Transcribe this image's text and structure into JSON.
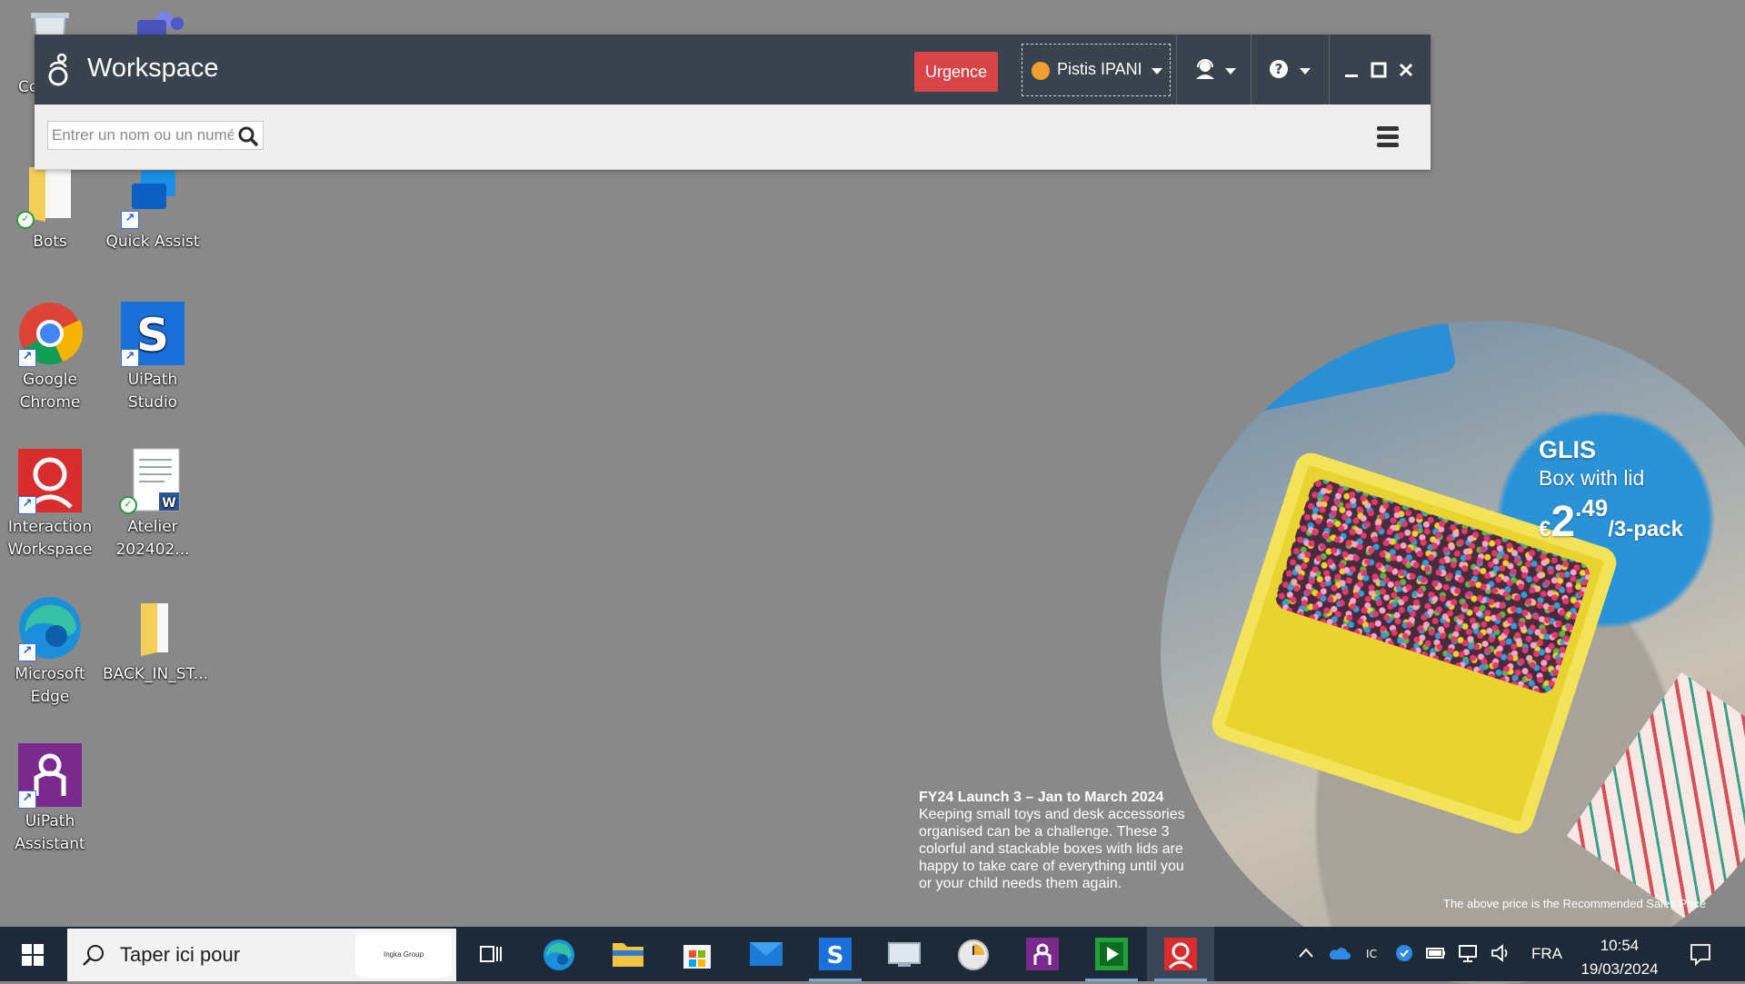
{
  "desktop": {
    "icons": [
      {
        "label": "Co",
        "icon": "recycle-bin-icon"
      },
      {
        "label": "",
        "icon": "teams-icon"
      },
      {
        "label": "Bots",
        "icon": "folder-icon"
      },
      {
        "label": "Quick Assist",
        "icon": "quick-assist-icon"
      },
      {
        "label": "Google Chrome",
        "icon": "chrome-icon"
      },
      {
        "label": "UiPath Studio",
        "icon": "uipath-studio-icon"
      },
      {
        "label": "Interaction Workspace",
        "icon": "interaction-workspace-icon"
      },
      {
        "label": "Atelier 202402...",
        "icon": "word-doc-icon"
      },
      {
        "label": "Microsoft Edge",
        "icon": "edge-icon"
      },
      {
        "label": "BACK_IN_ST...",
        "icon": "folder-icon"
      },
      {
        "label": "UiPath Assistant",
        "icon": "uipath-assistant-icon"
      }
    ]
  },
  "workspace": {
    "title": "Workspace",
    "urgence_label": "Urgence",
    "agent_name": "Pistis IPANI",
    "status_color": "#f0a030",
    "search_placeholder": "Entrer un nom ou un numéro",
    "colors": {
      "titlebar": "#39434d",
      "urgence": "#d84548",
      "toolbar": "#efefef"
    }
  },
  "promo": {
    "product_name": "GLIS",
    "product_desc": "Box with lid",
    "price_currency": "€",
    "price_main": "2",
    "price_cents": ".49",
    "price_unit": "/3-pack",
    "headline": "FY24 Launch 3 – Jan to March 2024",
    "body": "Keeping small toys and desk accessories organised can be a challenge. These 3 colorful and stackable boxes with lids are happy to take care of everything until you or your child needs them again.",
    "disclaimer": "The above price is the Recommended Sales Price"
  },
  "taskbar": {
    "search_placeholder": "Taper ici pour",
    "search_logo_text": "Ingka Group",
    "apps": [
      "task-view-icon",
      "edge-icon",
      "file-explorer-icon",
      "store-icon",
      "mail-icon",
      "uipath-studio-icon",
      "remote-desktop-icon",
      "clock-app-icon",
      "uipath-assistant-icon",
      "media-player-icon",
      "interaction-workspace-icon"
    ],
    "language": "FRA",
    "time": "10:54",
    "date": "19/03/2024"
  }
}
